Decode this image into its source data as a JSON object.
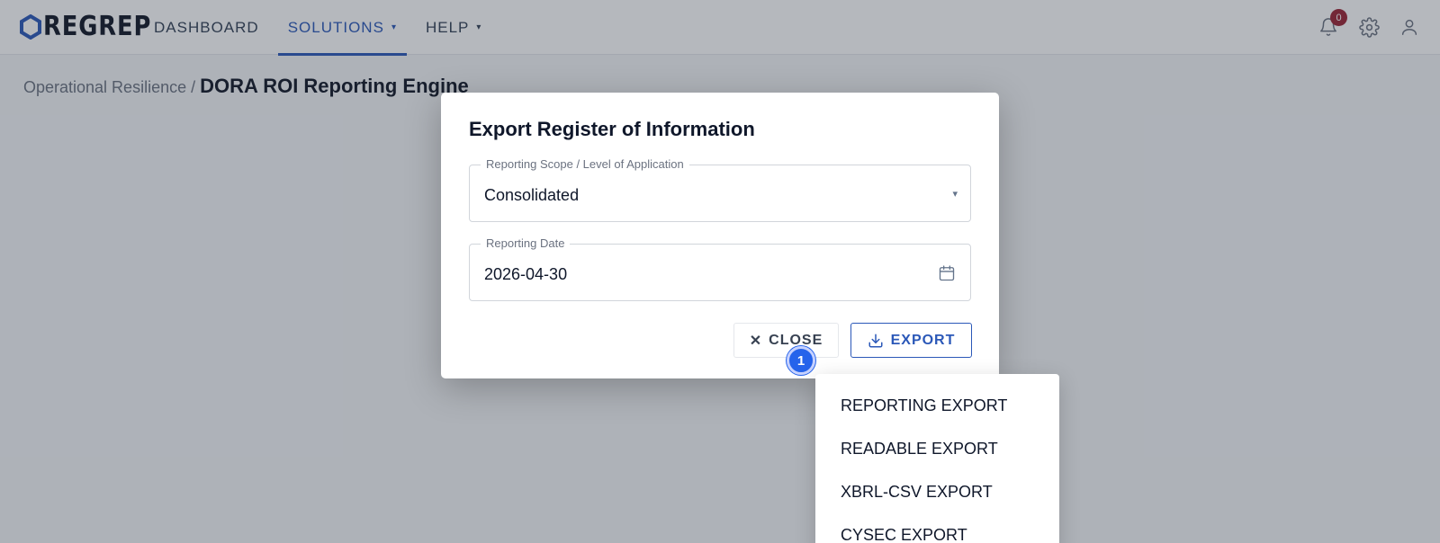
{
  "app": {
    "logo_text": "REGREP"
  },
  "nav": {
    "items": [
      {
        "label": "DASHBOARD"
      },
      {
        "label": "SOLUTIONS",
        "caret": "▾"
      },
      {
        "label": "HELP",
        "caret": "▾"
      }
    ],
    "notifications_count": "0"
  },
  "breadcrumb": {
    "parent": "Operational Resilience",
    "separator": "/",
    "current": "DORA ROI Reporting Engine"
  },
  "dialog": {
    "title": "Export Register of Information",
    "scope": {
      "label": "Reporting Scope / Level of Application",
      "value": "Consolidated",
      "caret": "▾"
    },
    "date": {
      "label": "Reporting Date",
      "value": "2026-04-30"
    },
    "close_label": "CLOSE",
    "close_icon": "✕",
    "export_label": "EXPORT"
  },
  "step_marker": "1",
  "export_menu": {
    "items": [
      "REPORTING EXPORT",
      "READABLE EXPORT",
      "XBRL-CSV EXPORT",
      "CYSEC EXPORT"
    ]
  },
  "colors": {
    "accent": "#2b58b8",
    "badge": "#9b2335",
    "marker": "#2563eb"
  },
  "icons": [
    "hexagon-logo-icon",
    "bell-icon",
    "gear-icon",
    "user-icon",
    "calendar-icon",
    "download-icon",
    "close-icon",
    "chevron-down-icon"
  ]
}
